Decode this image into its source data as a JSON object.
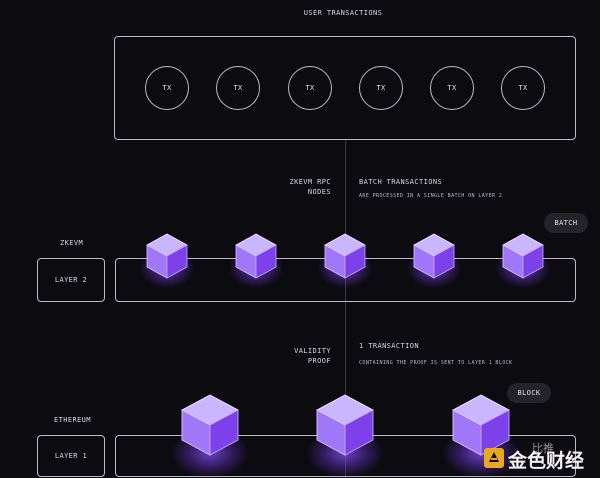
{
  "user_transactions": {
    "title": "USER TRANSACTIONS",
    "tx_labels": [
      "TX",
      "TX",
      "TX",
      "TX",
      "TX",
      "TX"
    ]
  },
  "rpc": {
    "line1": "ZKEVM RPC",
    "line2": "NODES"
  },
  "batch_transactions": {
    "title": "BATCH TRANSACTIONS",
    "subtitle": "ARE PROCESSED IN A SINGLE BATCH ON LAYER 2",
    "badge": "BATCH"
  },
  "layer2": {
    "network": "ZKEVM",
    "label": "LAYER 2"
  },
  "validity": {
    "line1": "VALIDITY",
    "line2": "PROOF"
  },
  "one_transaction": {
    "title": "1 TRANSACTION",
    "subtitle": "CONTAINING THE PROOF IS SENT TO LAYER 1 BLOCK",
    "badge": "BLOCK"
  },
  "layer1": {
    "network": "ETHEREUM",
    "label": "LAYER 1"
  },
  "colors": {
    "cube_top": "#c9b4ff",
    "cube_left": "#9f72f5",
    "cube_right": "#7b3fe6",
    "glow": "#8b52ff"
  },
  "watermark": {
    "text": "金色财经",
    "small": "比推"
  }
}
